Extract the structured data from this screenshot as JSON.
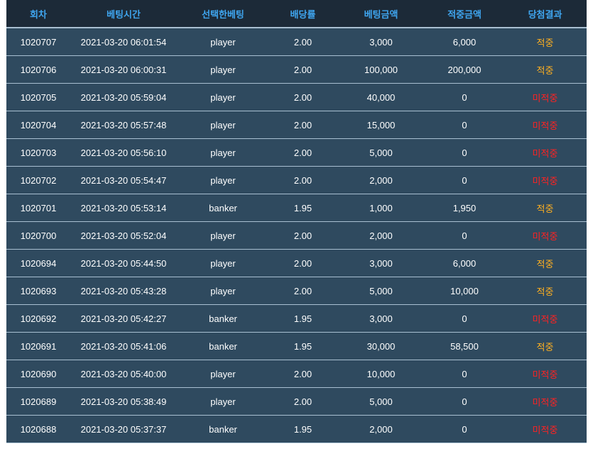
{
  "table": {
    "headers": [
      "회차",
      "베팅시간",
      "선택한베팅",
      "배당률",
      "베팅금액",
      "적중금액",
      "당첨결과"
    ],
    "rows": [
      {
        "round": "1020707",
        "time": "2021-03-20 06:01:54",
        "pick": "player",
        "odds": "2.00",
        "bet": "3,000",
        "win": "6,000",
        "result": "적중",
        "hit": true
      },
      {
        "round": "1020706",
        "time": "2021-03-20 06:00:31",
        "pick": "player",
        "odds": "2.00",
        "bet": "100,000",
        "win": "200,000",
        "result": "적중",
        "hit": true
      },
      {
        "round": "1020705",
        "time": "2021-03-20 05:59:04",
        "pick": "player",
        "odds": "2.00",
        "bet": "40,000",
        "win": "0",
        "result": "미적중",
        "hit": false
      },
      {
        "round": "1020704",
        "time": "2021-03-20 05:57:48",
        "pick": "player",
        "odds": "2.00",
        "bet": "15,000",
        "win": "0",
        "result": "미적중",
        "hit": false
      },
      {
        "round": "1020703",
        "time": "2021-03-20 05:56:10",
        "pick": "player",
        "odds": "2.00",
        "bet": "5,000",
        "win": "0",
        "result": "미적중",
        "hit": false
      },
      {
        "round": "1020702",
        "time": "2021-03-20 05:54:47",
        "pick": "player",
        "odds": "2.00",
        "bet": "2,000",
        "win": "0",
        "result": "미적중",
        "hit": false
      },
      {
        "round": "1020701",
        "time": "2021-03-20 05:53:14",
        "pick": "banker",
        "odds": "1.95",
        "bet": "1,000",
        "win": "1,950",
        "result": "적중",
        "hit": true
      },
      {
        "round": "1020700",
        "time": "2021-03-20 05:52:04",
        "pick": "player",
        "odds": "2.00",
        "bet": "2,000",
        "win": "0",
        "result": "미적중",
        "hit": false
      },
      {
        "round": "1020694",
        "time": "2021-03-20 05:44:50",
        "pick": "player",
        "odds": "2.00",
        "bet": "3,000",
        "win": "6,000",
        "result": "적중",
        "hit": true
      },
      {
        "round": "1020693",
        "time": "2021-03-20 05:43:28",
        "pick": "player",
        "odds": "2.00",
        "bet": "5,000",
        "win": "10,000",
        "result": "적중",
        "hit": true
      },
      {
        "round": "1020692",
        "time": "2021-03-20 05:42:27",
        "pick": "banker",
        "odds": "1.95",
        "bet": "3,000",
        "win": "0",
        "result": "미적중",
        "hit": false
      },
      {
        "round": "1020691",
        "time": "2021-03-20 05:41:06",
        "pick": "banker",
        "odds": "1.95",
        "bet": "30,000",
        "win": "58,500",
        "result": "적중",
        "hit": true
      },
      {
        "round": "1020690",
        "time": "2021-03-20 05:40:00",
        "pick": "player",
        "odds": "2.00",
        "bet": "10,000",
        "win": "0",
        "result": "미적중",
        "hit": false
      },
      {
        "round": "1020689",
        "time": "2021-03-20 05:38:49",
        "pick": "player",
        "odds": "2.00",
        "bet": "5,000",
        "win": "0",
        "result": "미적중",
        "hit": false
      },
      {
        "round": "1020688",
        "time": "2021-03-20 05:37:37",
        "pick": "banker",
        "odds": "1.95",
        "bet": "2,000",
        "win": "0",
        "result": "미적중",
        "hit": false
      }
    ]
  },
  "colors": {
    "header_bg": "#1c2a38",
    "header_text": "#3fa6f0",
    "row_bg": "#2f4a5f",
    "hit": "#ffb020",
    "miss": "#ff2222"
  }
}
